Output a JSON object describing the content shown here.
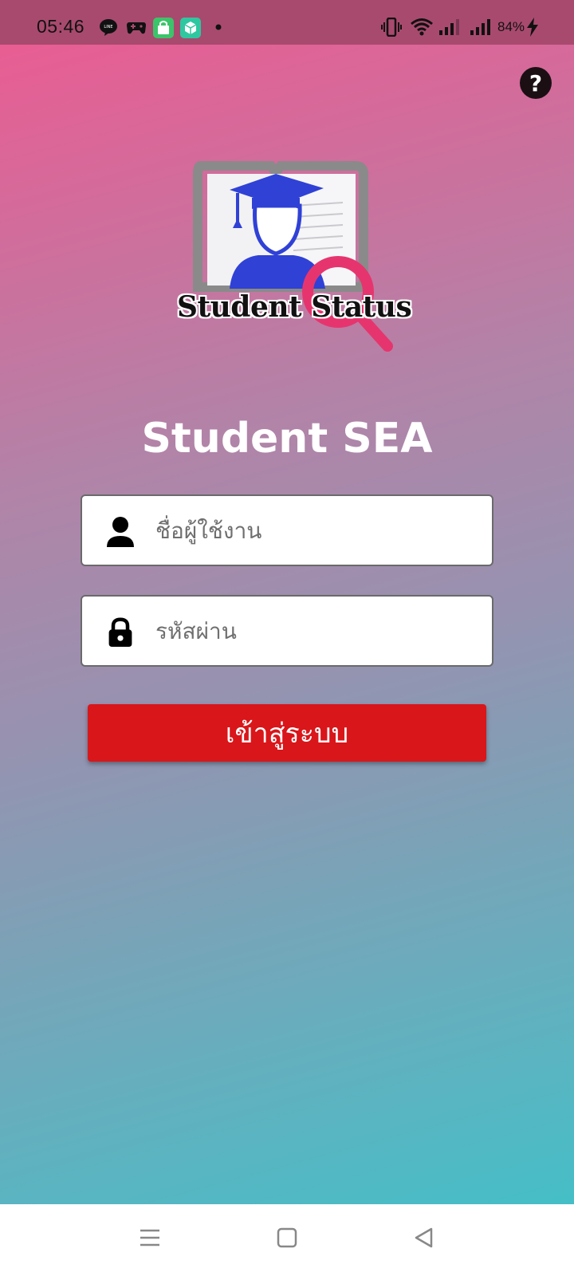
{
  "status_bar": {
    "time": "05:46",
    "battery_percent": "84%",
    "notification_icons": [
      "line-icon",
      "game-controller-icon",
      "shop-icon",
      "box-icon",
      "dot-icon"
    ],
    "system_icons": [
      "vibrate-icon",
      "wifi-icon",
      "signal-icon",
      "signal-icon",
      "battery-charging-icon"
    ]
  },
  "header": {
    "help_icon": "help-icon"
  },
  "logo": {
    "text": "Student Status",
    "colors": {
      "cap": "#3041d6",
      "magnifier": "#e6356e",
      "book": "#8a8a8a"
    }
  },
  "title": "Student SEA",
  "form": {
    "username": {
      "placeholder": "ชื่อผู้ใช้งาน",
      "value": "",
      "icon": "user-icon"
    },
    "password": {
      "placeholder": "รหัสผ่าน",
      "value": "",
      "icon": "lock-icon"
    },
    "login_label": "เข้าสู่ระบบ"
  },
  "theme": {
    "gradient_top": "#ee5a91",
    "gradient_bottom": "#3bc3c9",
    "button_color": "#d9161a"
  },
  "nav_bar": {
    "icons": [
      "menu-icon",
      "home-icon",
      "back-icon"
    ]
  }
}
